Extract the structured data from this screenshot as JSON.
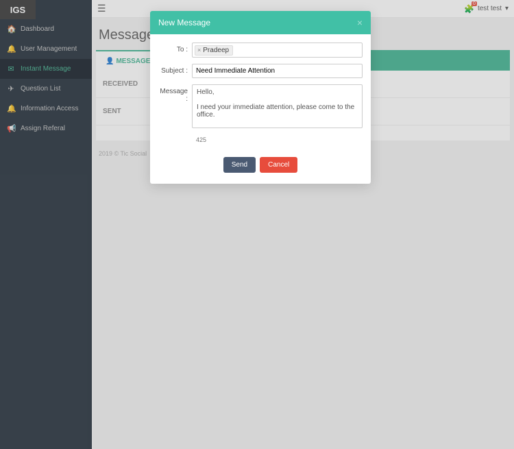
{
  "logo": "IGS",
  "sidebar": {
    "items": [
      {
        "icon": "🏠",
        "label": "Dashboard"
      },
      {
        "icon": "🔔",
        "label": "User Management"
      },
      {
        "icon": "✉",
        "label": "Instant Message"
      },
      {
        "icon": "✈",
        "label": "Question List"
      },
      {
        "icon": "🔔",
        "label": "Information Access"
      },
      {
        "icon": "📢",
        "label": "Assign Referal"
      }
    ]
  },
  "topbar": {
    "user": "test test",
    "caret": "▾",
    "notif_count": "0"
  },
  "page": {
    "title": "Messages"
  },
  "tabs": {
    "message": "MESSAGE"
  },
  "sections": {
    "received": "RECEIVED",
    "sent": "SENT"
  },
  "footer": "2019 © Tic Social",
  "modal": {
    "title": "New Message",
    "labels": {
      "to": "To :",
      "subject": "Subject :",
      "message": "Message :"
    },
    "to_token": "Pradeep",
    "subject_value": "Need Immediate Attention",
    "message_value": "Hello,\n\nI need your immediate attention, please come to the office.",
    "char_count": "425",
    "buttons": {
      "send": "Send",
      "cancel": "Cancel"
    }
  }
}
